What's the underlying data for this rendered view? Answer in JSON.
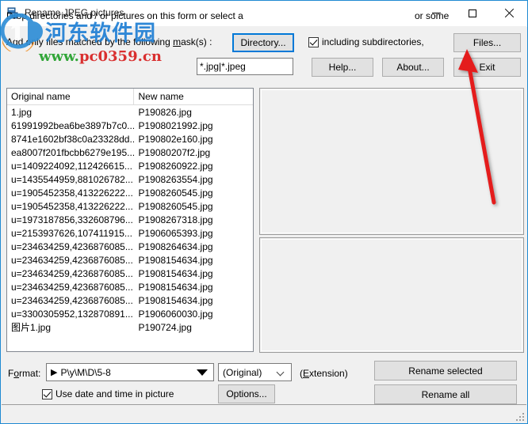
{
  "window": {
    "title": "Rename JPEG pictures",
    "icon": "app-window-icon",
    "minimize_glyph": "minimize-icon",
    "maximize_glyph": "maximize-icon",
    "close_glyph": "close-icon",
    "border_color": "#1f8ad2"
  },
  "watermark": {
    "site_name_cn": "河东软件园",
    "url_prefix": "www.",
    "url_domain": "pc0359.cn",
    "color_cn": "#1f7fd4",
    "color_url_prefix": "#22a02a",
    "color_url_domain": "#d81f1f"
  },
  "top": {
    "drop_label": "Drop directories and / or pictures on this form or select a",
    "directory_button": "Directory...",
    "include_subdirs_label": "including subdirectories,",
    "include_subdirs_checked": true,
    "or_some_label": "or some",
    "files_button": "Files...",
    "mask_label_before": "Add only files matched by the following ",
    "mask_label_accel": "m",
    "mask_label_after": "ask(s) :",
    "mask_value": "*.jpg|*.jpeg",
    "help_button": "Help...",
    "about_button": "About...",
    "exit_button": "Exit",
    "focus_color": "#0078d7"
  },
  "list": {
    "columns": [
      "Original name",
      "New name"
    ],
    "rows": [
      {
        "original": "1.jpg",
        "new": "P190826.jpg"
      },
      {
        "original": "61991992bea6be3897b7c0...",
        "new": "P1908021992.jpg"
      },
      {
        "original": "8741e1602bf38c0a23328dd...",
        "new": "P190802e160.jpg"
      },
      {
        "original": "ea8007f201fbcbb6279e195...",
        "new": "P19080207f2.jpg"
      },
      {
        "original": "u=1409224092,112426615...",
        "new": "P1908260922.jpg"
      },
      {
        "original": "u=1435544959,881026782...",
        "new": "P1908263554.jpg"
      },
      {
        "original": "u=1905452358,413226222...",
        "new": "P1908260545.jpg"
      },
      {
        "original": "u=1905452358,413226222...",
        "new": "P1908260545.jpg"
      },
      {
        "original": "u=1973187856,332608796...",
        "new": "P1908267318.jpg"
      },
      {
        "original": "u=2153937626,107411915...",
        "new": "P1906065393.jpg"
      },
      {
        "original": "u=234634259,4236876085...",
        "new": "P1908264634.jpg"
      },
      {
        "original": "u=234634259,4236876085...",
        "new": "P1908154634.jpg"
      },
      {
        "original": "u=234634259,4236876085...",
        "new": "P1908154634.jpg"
      },
      {
        "original": "u=234634259,4236876085...",
        "new": "P1908154634.jpg"
      },
      {
        "original": "u=234634259,4236876085...",
        "new": "P1908154634.jpg"
      },
      {
        "original": "u=3300305952,132870891...",
        "new": "P1906060030.jpg"
      },
      {
        "original": "图片1.jpg",
        "new": "P190724.jpg"
      }
    ]
  },
  "preview": {
    "top_panel": "",
    "bottom_panel": ""
  },
  "bottom": {
    "format_label_before": "F",
    "format_label_accel": "o",
    "format_label_after": "rmat:",
    "format_prefix_icon": "play-triangle-icon",
    "format_value": "P\\y\\M\\D\\5-8",
    "extension_value": "(Original)",
    "extension_label_before": "(",
    "extension_label_accel": "E",
    "extension_label_after": "xtension)",
    "use_date_label": "Use date and time in picture",
    "use_date_checked": true,
    "options_button": "Options...",
    "rename_selected_button": "Rename selected",
    "rename_all_button": "Rename all"
  },
  "statusbar": {
    "text": "",
    "grip": "resize-grip-icon"
  },
  "annotation": {
    "arrow_color": "#e41e1e",
    "points_to": "Files..."
  }
}
